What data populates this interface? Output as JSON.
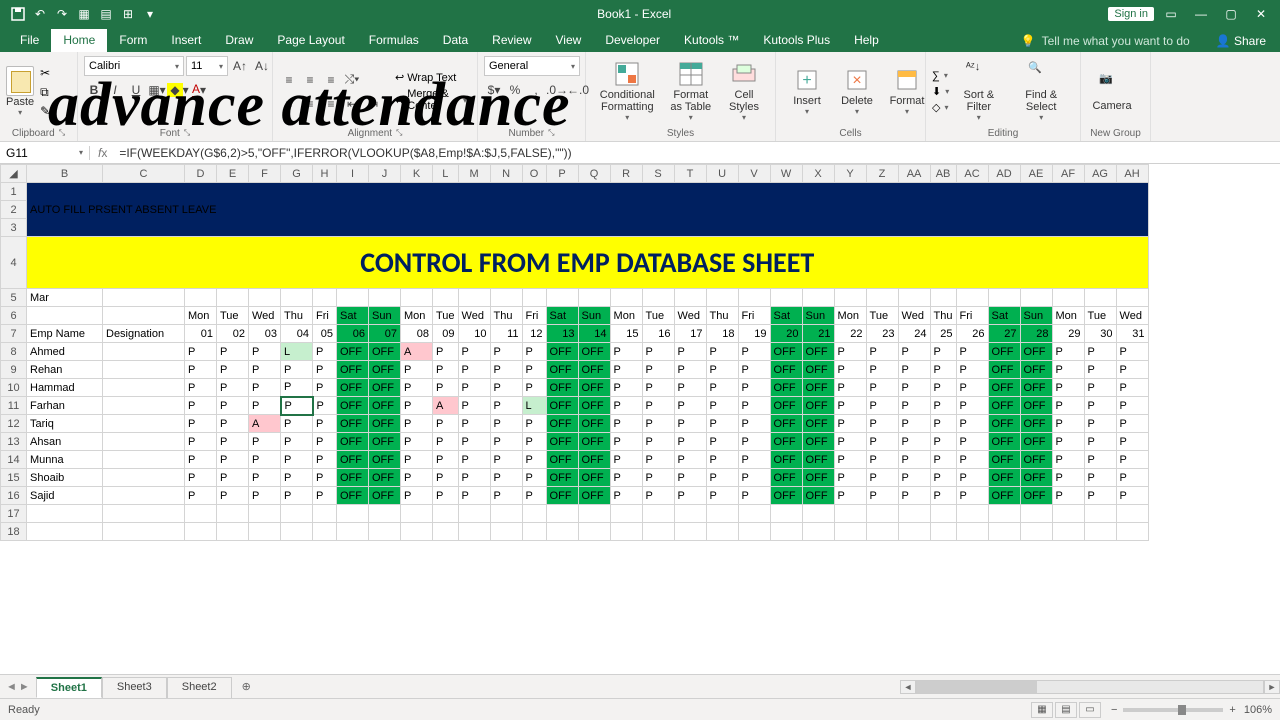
{
  "app": {
    "title": "Book1 - Excel",
    "signin": "Sign in"
  },
  "tabs": [
    "File",
    "Home",
    "Form",
    "Insert",
    "Draw",
    "Page Layout",
    "Formulas",
    "Data",
    "Review",
    "View",
    "Developer",
    "Kutools ™",
    "Kutools Plus",
    "Help"
  ],
  "active_tab": "Home",
  "tellme": "Tell me what you want to do",
  "share": "Share",
  "ribbon": {
    "clipboard": {
      "label": "Clipboard",
      "paste": "Paste"
    },
    "font": {
      "label": "Font",
      "name": "Calibri",
      "size": "11"
    },
    "alignment": {
      "label": "Alignment",
      "wrap": "Wrap Text",
      "merge": "Merge & Center"
    },
    "number": {
      "label": "Number",
      "format": "General"
    },
    "styles": {
      "label": "Styles",
      "cf": "Conditional Formatting",
      "fat": "Format as Table",
      "cs": "Cell Styles"
    },
    "cells": {
      "label": "Cells",
      "insert": "Insert",
      "delete": "Delete",
      "format": "Format"
    },
    "editing": {
      "label": "Editing",
      "sort": "Sort & Filter",
      "find": "Find & Select"
    },
    "newgroup": {
      "label": "New Group",
      "camera": "Camera"
    }
  },
  "namebox": "G11",
  "formula": "=IF(WEEKDAY(G$6,2)>5,\"OFF\",IFERROR(VLOOKUP($A8,Emp!$A:$J,5,FALSE),\"\"))",
  "overlay": "advance attendance",
  "merged": {
    "title1": "AUTO FILL  PRSENT ABSENT  LEAVE",
    "title2": "CONTROL FROM EMP DATABASE SHEET"
  },
  "month": "Mar",
  "headers": {
    "emp": "Emp Name",
    "des": "Designation"
  },
  "days": [
    "Mon",
    "Tue",
    "Wed",
    "Thu",
    "Fri",
    "Sat",
    "Sun",
    "Mon",
    "Tue",
    "Wed",
    "Thu",
    "Fri",
    "Sat",
    "Sun",
    "Mon",
    "Tue",
    "Wed",
    "Thu",
    "Fri",
    "Sat",
    "Sun",
    "Mon",
    "Tue",
    "Wed",
    "Thu",
    "Fri",
    "Sat",
    "Sun",
    "Mon",
    "Tue",
    "Wed"
  ],
  "dates": [
    "01",
    "02",
    "03",
    "04",
    "05",
    "06",
    "07",
    "08",
    "09",
    "10",
    "11",
    "12",
    "13",
    "14",
    "15",
    "16",
    "17",
    "18",
    "19",
    "20",
    "21",
    "22",
    "23",
    "24",
    "25",
    "26",
    "27",
    "28",
    "29",
    "30",
    "31"
  ],
  "weekend_cols": [
    5,
    6,
    12,
    13,
    19,
    20,
    26,
    27
  ],
  "employees": [
    {
      "name": "Ahmed",
      "att": [
        "P",
        "P",
        "P",
        "L",
        "P",
        "OFF",
        "OFF",
        "A",
        "P",
        "P",
        "P",
        "P",
        "OFF",
        "OFF",
        "P",
        "P",
        "P",
        "P",
        "P",
        "OFF",
        "OFF",
        "P",
        "P",
        "P",
        "P",
        "P",
        "OFF",
        "OFF",
        "P",
        "P",
        "P"
      ]
    },
    {
      "name": "Rehan",
      "att": [
        "P",
        "P",
        "P",
        "P",
        "P",
        "OFF",
        "OFF",
        "P",
        "P",
        "P",
        "P",
        "P",
        "OFF",
        "OFF",
        "P",
        "P",
        "P",
        "P",
        "P",
        "OFF",
        "OFF",
        "P",
        "P",
        "P",
        "P",
        "P",
        "OFF",
        "OFF",
        "P",
        "P",
        "P"
      ]
    },
    {
      "name": "Hammad",
      "att": [
        "P",
        "P",
        "P",
        "P",
        "P",
        "OFF",
        "OFF",
        "P",
        "P",
        "P",
        "P",
        "P",
        "OFF",
        "OFF",
        "P",
        "P",
        "P",
        "P",
        "P",
        "OFF",
        "OFF",
        "P",
        "P",
        "P",
        "P",
        "P",
        "OFF",
        "OFF",
        "P",
        "P",
        "P"
      ]
    },
    {
      "name": "Farhan",
      "att": [
        "P",
        "P",
        "P",
        "P",
        "P",
        "OFF",
        "OFF",
        "P",
        "A",
        "P",
        "P",
        "L",
        "OFF",
        "OFF",
        "P",
        "P",
        "P",
        "P",
        "P",
        "OFF",
        "OFF",
        "P",
        "P",
        "P",
        "P",
        "P",
        "OFF",
        "OFF",
        "P",
        "P",
        "P"
      ]
    },
    {
      "name": "Tariq",
      "att": [
        "P",
        "P",
        "A",
        "P",
        "P",
        "OFF",
        "OFF",
        "P",
        "P",
        "P",
        "P",
        "P",
        "OFF",
        "OFF",
        "P",
        "P",
        "P",
        "P",
        "P",
        "OFF",
        "OFF",
        "P",
        "P",
        "P",
        "P",
        "P",
        "OFF",
        "OFF",
        "P",
        "P",
        "P"
      ]
    },
    {
      "name": "Ahsan",
      "att": [
        "P",
        "P",
        "P",
        "P",
        "P",
        "OFF",
        "OFF",
        "P",
        "P",
        "P",
        "P",
        "P",
        "OFF",
        "OFF",
        "P",
        "P",
        "P",
        "P",
        "P",
        "OFF",
        "OFF",
        "P",
        "P",
        "P",
        "P",
        "P",
        "OFF",
        "OFF",
        "P",
        "P",
        "P"
      ]
    },
    {
      "name": "Munna",
      "att": [
        "P",
        "P",
        "P",
        "P",
        "P",
        "OFF",
        "OFF",
        "P",
        "P",
        "P",
        "P",
        "P",
        "OFF",
        "OFF",
        "P",
        "P",
        "P",
        "P",
        "P",
        "OFF",
        "OFF",
        "P",
        "P",
        "P",
        "P",
        "P",
        "OFF",
        "OFF",
        "P",
        "P",
        "P"
      ]
    },
    {
      "name": "Shoaib",
      "att": [
        "P",
        "P",
        "P",
        "P",
        "P",
        "OFF",
        "OFF",
        "P",
        "P",
        "P",
        "P",
        "P",
        "OFF",
        "OFF",
        "P",
        "P",
        "P",
        "P",
        "P",
        "OFF",
        "OFF",
        "P",
        "P",
        "P",
        "P",
        "P",
        "OFF",
        "OFF",
        "P",
        "P",
        "P"
      ]
    },
    {
      "name": "Sajid",
      "att": [
        "P",
        "P",
        "P",
        "P",
        "P",
        "OFF",
        "OFF",
        "P",
        "P",
        "P",
        "P",
        "P",
        "OFF",
        "OFF",
        "P",
        "P",
        "P",
        "P",
        "P",
        "OFF",
        "OFF",
        "P",
        "P",
        "P",
        "P",
        "P",
        "OFF",
        "OFF",
        "P",
        "P",
        "P"
      ]
    }
  ],
  "columns_letters": [
    "B",
    "C",
    "D",
    "E",
    "F",
    "G",
    "H",
    "I",
    "J",
    "K",
    "L",
    "M",
    "N",
    "O",
    "P",
    "Q",
    "R",
    "S",
    "T",
    "U",
    "V",
    "W",
    "X",
    "Y",
    "Z",
    "AA",
    "AB",
    "AC",
    "AD",
    "AE",
    "AF",
    "AG",
    "AH"
  ],
  "sheets": {
    "active": "Sheet1",
    "list": [
      "Sheet1",
      "Sheet3",
      "Sheet2"
    ]
  },
  "status": {
    "ready": "Ready",
    "zoom": "106%"
  }
}
